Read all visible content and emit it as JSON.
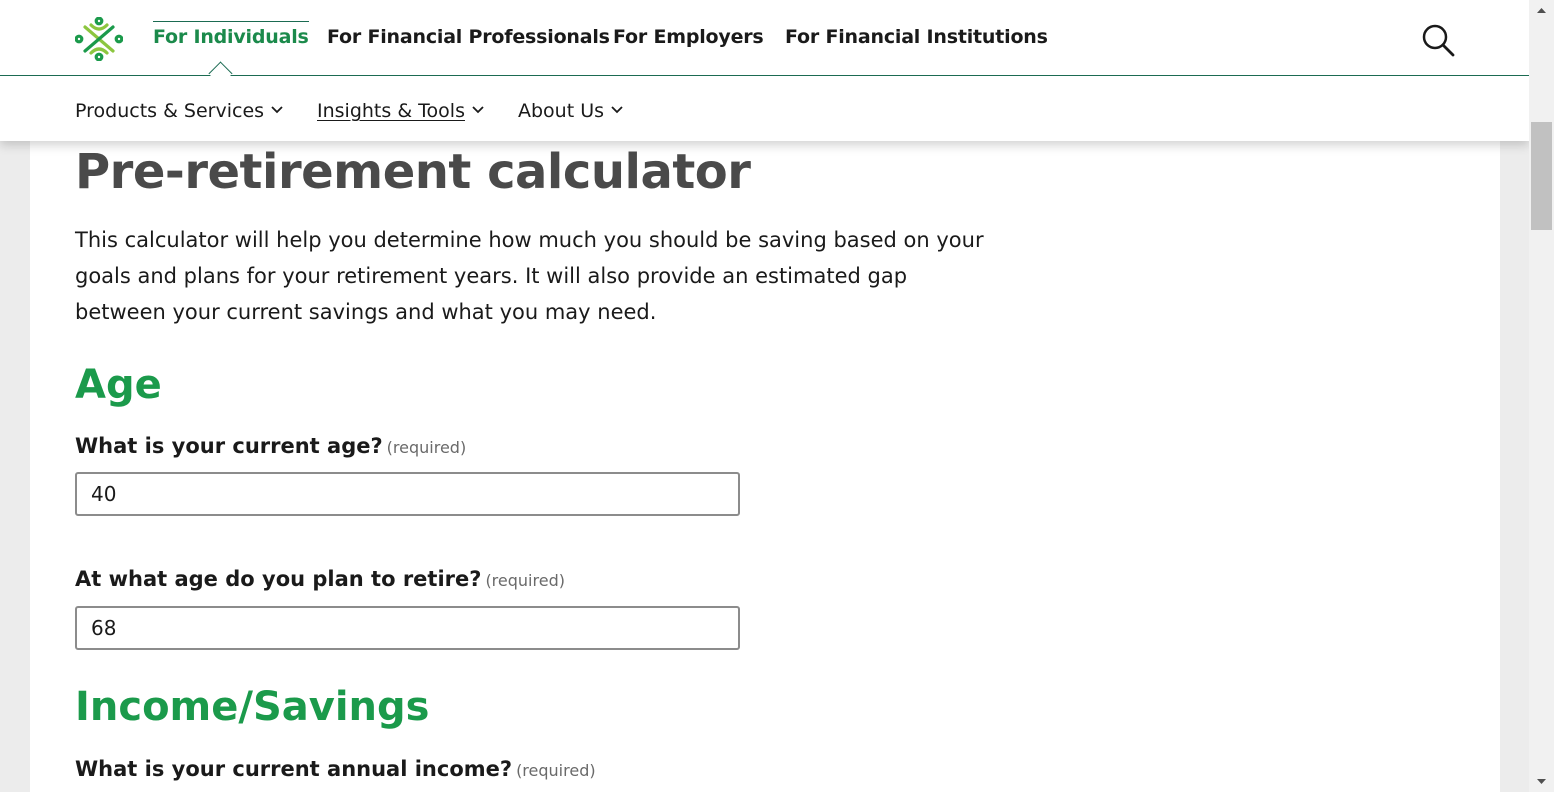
{
  "header": {
    "audience_tabs": [
      {
        "label": "For Individuals",
        "active": true
      },
      {
        "label": "For Financial Professionals",
        "active": false
      },
      {
        "label": "For Employers",
        "active": false
      },
      {
        "label": "For Financial Institutions",
        "active": false
      }
    ],
    "search_icon": "search-icon",
    "logo_icon": "brand-logo",
    "subnav": [
      {
        "label": "Products & Services"
      },
      {
        "label": "Insights & Tools"
      },
      {
        "label": "About Us"
      }
    ]
  },
  "colors": {
    "brand_green": "#1b9a4b",
    "title_gray": "#4a4a4a",
    "header_line": "#1b6b52"
  },
  "main": {
    "title": "Pre-retirement calculator",
    "intro": "This calculator will help you determine how much you should be saving based on your goals and plans for your retirement years. It will also provide an estimated gap between your current savings and what you may need.",
    "sections": {
      "age": {
        "heading": "Age",
        "current_age": {
          "label": "What is your current age?",
          "required": "(required)",
          "value": "40"
        },
        "retire_age": {
          "label": "At what age do you plan to retire?",
          "required": "(required)",
          "value": "68"
        }
      },
      "income": {
        "heading": "Income/Savings",
        "annual_income": {
          "label": "What is your current annual income?",
          "required": "(required)"
        }
      }
    }
  }
}
